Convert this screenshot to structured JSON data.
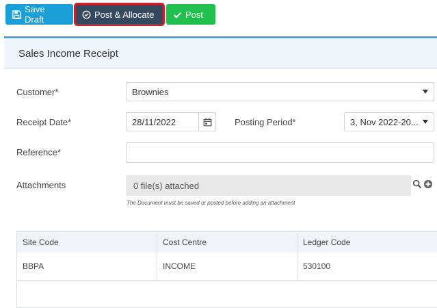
{
  "toolbar": {
    "save_draft_label": "Save Draft",
    "post_allocate_label": "Post & Allocate",
    "post_label": "Post"
  },
  "panel": {
    "title": "Sales Income Receipt"
  },
  "form": {
    "customer_label": "Customer*",
    "customer_value": "Brownies",
    "receipt_date_label": "Receipt Date*",
    "receipt_date_value": "28/11/2022",
    "posting_period_label": "Posting Period*",
    "posting_period_value": "3, Nov 2022-20...",
    "reference_label": "Reference*",
    "reference_value": "",
    "attachments_label": "Attachments",
    "attachments_value": "0 file(s) attached",
    "attachments_hint": "The Document must be saved or posted before adding an attachment"
  },
  "grid": {
    "columns": [
      "Site Code",
      "Cost Centre",
      "Ledger Code"
    ],
    "rows": [
      [
        "BBPA",
        "INCOME",
        "530100"
      ]
    ]
  },
  "colors": {
    "save_draft": "#1a9fd9",
    "post_allocate": "#34495e",
    "post": "#21c04e",
    "highlight": "#d0202a",
    "panel_accent": "#3ea7e1"
  }
}
